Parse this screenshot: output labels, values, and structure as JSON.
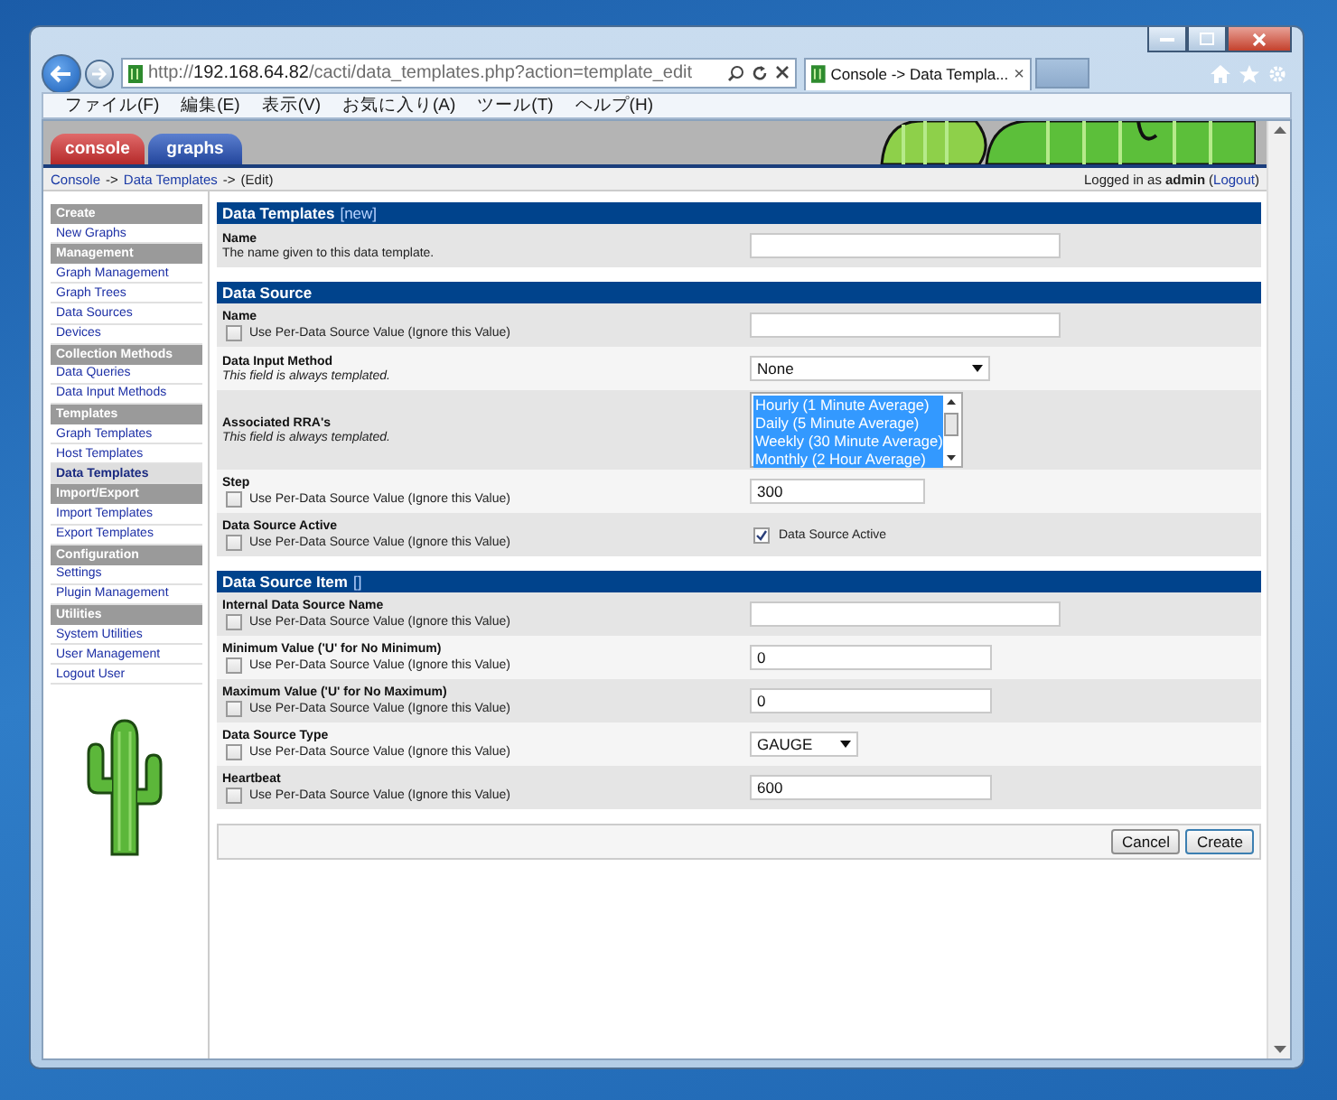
{
  "browser": {
    "address": {
      "scheme": "http://",
      "host": "192.168.64.82",
      "path": "/cacti/data_templates.php?action=template_edit"
    },
    "tab": {
      "title": "Console -> Data Templa...",
      "close": "×"
    },
    "menu": [
      "ファイル(F)",
      "編集(E)",
      "表示(V)",
      "お気に入り(A)",
      "ツール(T)",
      "ヘルプ(H)"
    ]
  },
  "app_tabs": [
    {
      "label": "console",
      "selected": true
    },
    {
      "label": "graphs",
      "selected": false
    }
  ],
  "breadcrumb": {
    "items": [
      {
        "label": "Console",
        "link": true
      },
      {
        "label": "Data Templates",
        "link": true
      },
      {
        "label": "(Edit)",
        "link": false
      }
    ],
    "separator": "->"
  },
  "login": {
    "text": "Logged in as",
    "user": "admin",
    "open": "(",
    "logout": "Logout",
    "close": ")"
  },
  "sidebar": [
    {
      "kind": "heading",
      "label": "Create"
    },
    {
      "kind": "link",
      "label": "New Graphs",
      "selected": false
    },
    {
      "kind": "heading",
      "label": "Management"
    },
    {
      "kind": "link",
      "label": "Graph Management",
      "selected": false
    },
    {
      "kind": "link",
      "label": "Graph Trees",
      "selected": false
    },
    {
      "kind": "link",
      "label": "Data Sources",
      "selected": false
    },
    {
      "kind": "link",
      "label": "Devices",
      "selected": false
    },
    {
      "kind": "heading",
      "label": "Collection Methods"
    },
    {
      "kind": "link",
      "label": "Data Queries",
      "selected": false
    },
    {
      "kind": "link",
      "label": "Data Input Methods",
      "selected": false
    },
    {
      "kind": "heading",
      "label": "Templates"
    },
    {
      "kind": "link",
      "label": "Graph Templates",
      "selected": false
    },
    {
      "kind": "link",
      "label": "Host Templates",
      "selected": false
    },
    {
      "kind": "link",
      "label": "Data Templates",
      "selected": true
    },
    {
      "kind": "heading",
      "label": "Import/Export"
    },
    {
      "kind": "link",
      "label": "Import Templates",
      "selected": false
    },
    {
      "kind": "link",
      "label": "Export Templates",
      "selected": false
    },
    {
      "kind": "heading",
      "label": "Configuration"
    },
    {
      "kind": "link",
      "label": "Settings",
      "selected": false
    },
    {
      "kind": "link",
      "label": "Plugin Management",
      "selected": false
    },
    {
      "kind": "heading",
      "label": "Utilities"
    },
    {
      "kind": "link",
      "label": "System Utilities",
      "selected": false
    },
    {
      "kind": "link",
      "label": "User Management",
      "selected": false
    },
    {
      "kind": "link",
      "label": "Logout User",
      "selected": false
    }
  ],
  "sections": [
    {
      "title": "Data Templates",
      "tag": "[new]",
      "rows": [
        {
          "label": "Name",
          "description": {
            "kind": "plain",
            "text": "The name given to this data template."
          },
          "control": {
            "kind": "text"
          }
        }
      ]
    },
    {
      "title": "Data Source",
      "rows": [
        {
          "label": "Name",
          "description": {
            "kind": "override",
            "text": "Use Per-Data Source Value (Ignore this Value)",
            "checked": false
          },
          "control": {
            "kind": "text"
          }
        },
        {
          "label": "Data Input Method",
          "description": {
            "kind": "italic",
            "text": "This field is always templated."
          },
          "control": {
            "kind": "select",
            "value": "None",
            "wide": true
          }
        },
        {
          "label": "Associated RRA's",
          "description": {
            "kind": "italic",
            "text": "This field is always templated."
          },
          "control": {
            "kind": "listbox",
            "options": [
              {
                "label": "Hourly (1 Minute Average)",
                "selected": true
              },
              {
                "label": "Daily (5 Minute Average)",
                "selected": true
              },
              {
                "label": "Weekly (30 Minute Average)",
                "selected": true
              },
              {
                "label": "Monthly (2 Hour Average)",
                "selected": true
              }
            ]
          }
        },
        {
          "label": "Step",
          "description": {
            "kind": "override",
            "text": "Use Per-Data Source Value (Ignore this Value)",
            "checked": false
          },
          "control": {
            "kind": "number",
            "value": "300",
            "short": true
          }
        },
        {
          "label": "Data Source Active",
          "description": {
            "kind": "override",
            "text": "Use Per-Data Source Value (Ignore this Value)",
            "checked": false
          },
          "control": {
            "kind": "checkbox",
            "label": "Data Source Active",
            "checked": true
          }
        }
      ]
    },
    {
      "title": "Data Source Item",
      "tag": "[]",
      "rows": [
        {
          "label": "Internal Data Source Name",
          "description": {
            "kind": "override",
            "text": "Use Per-Data Source Value (Ignore this Value)",
            "checked": false
          },
          "control": {
            "kind": "text"
          }
        },
        {
          "label": "Minimum Value ('U' for No Minimum)",
          "description": {
            "kind": "override",
            "text": "Use Per-Data Source Value (Ignore this Value)",
            "checked": false
          },
          "control": {
            "kind": "number",
            "value": "0",
            "short": false
          }
        },
        {
          "label": "Maximum Value ('U' for No Maximum)",
          "description": {
            "kind": "override",
            "text": "Use Per-Data Source Value (Ignore this Value)",
            "checked": false
          },
          "control": {
            "kind": "number",
            "value": "0",
            "short": false
          }
        },
        {
          "label": "Data Source Type",
          "description": {
            "kind": "override",
            "text": "Use Per-Data Source Value (Ignore this Value)",
            "checked": false
          },
          "control": {
            "kind": "select",
            "value": "GAUGE",
            "wide": false
          }
        },
        {
          "label": "Heartbeat",
          "description": {
            "kind": "override",
            "text": "Use Per-Data Source Value (Ignore this Value)",
            "checked": false
          },
          "control": {
            "kind": "number",
            "value": "600",
            "short": false
          }
        }
      ]
    }
  ],
  "buttons": [
    {
      "label": "Cancel",
      "default": false
    },
    {
      "label": "Create",
      "default": true
    }
  ]
}
